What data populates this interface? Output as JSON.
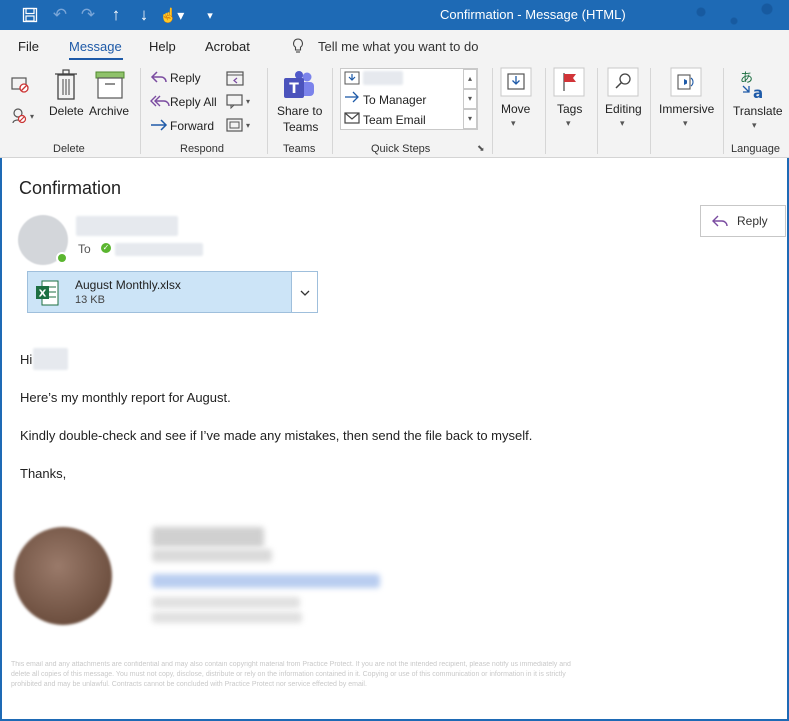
{
  "window": {
    "title": "Confirmation  -  Message (HTML)"
  },
  "tabs": {
    "file": "File",
    "message": "Message",
    "help": "Help",
    "acrobat": "Acrobat",
    "tell_me": "Tell me what you want to do"
  },
  "ribbon": {
    "delete_group": {
      "label": "Delete",
      "delete": "Delete",
      "archive": "Archive"
    },
    "respond_group": {
      "label": "Respond",
      "reply": "Reply",
      "reply_all": "Reply All",
      "forward": "Forward"
    },
    "teams_group": {
      "label": "Teams",
      "share_line1": "Share to",
      "share_line2": "Teams"
    },
    "quick_steps": {
      "label": "Quick Steps",
      "to_manager": "To Manager",
      "team_email": "Team Email"
    },
    "move": "Move",
    "tags": "Tags",
    "editing": "Editing",
    "immersive": "Immersive",
    "translate": "Translate",
    "language_group": "Language"
  },
  "message": {
    "subject": "Confirmation",
    "to_label": "To",
    "reply_button": "Reply",
    "attachment": {
      "name": "August Monthly.xlsx",
      "size": "13 KB"
    },
    "body": {
      "greeting": "Hi",
      "line1": "Here’s my monthly report for August.",
      "line2": "Kindly double-check and see if I’ve made any mistakes, then send the file back to myself.",
      "closing": "Thanks,"
    },
    "disclaimer": "This email and any attachments are confidential and may also contain copyright material from Practice Protect. If you are not the intended recipient, please notify us immediately and delete all copies of this message. You must not copy, disclose, distribute or rely on the information contained in it. Copying or use of this communication or information in it is strictly prohibited and may be unlawful. Contracts cannot be concluded with Practice Protect nor service effected by email."
  },
  "colors": {
    "title_bar": "#1e6ab5",
    "accent": "#1e5aa8",
    "attachment_bg": "#cce4f7",
    "excel_green": "#1d6f42",
    "presence_green": "#5ab52f"
  }
}
